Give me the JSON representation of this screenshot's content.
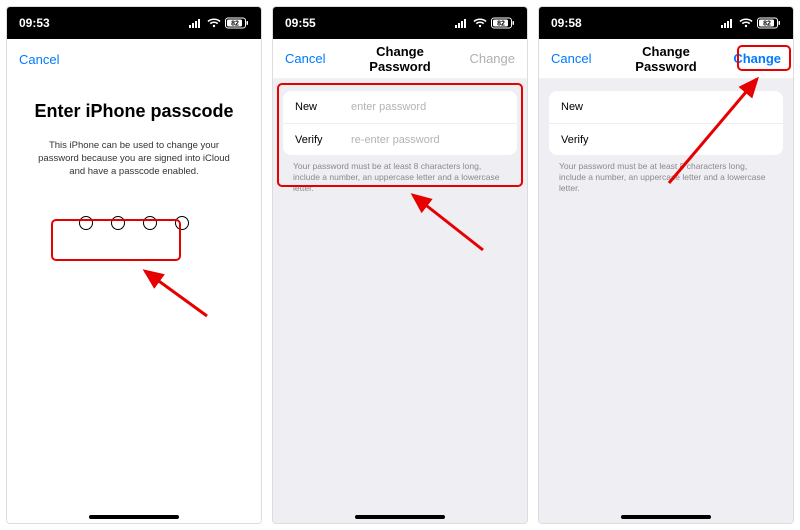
{
  "status": {
    "battery": "82"
  },
  "screens": {
    "s1": {
      "time": "09:53",
      "cancel": "Cancel",
      "title": "Enter iPhone passcode",
      "desc": "This iPhone can be used to change your password because you are signed into iCloud and have a passcode enabled."
    },
    "s2": {
      "time": "09:55",
      "cancel": "Cancel",
      "title": "Change Password",
      "change": "Change",
      "new_label": "New",
      "new_placeholder": "enter password",
      "verify_label": "Verify",
      "verify_placeholder": "re-enter password",
      "hint": "Your password must be at least 8 characters long, include a number, an uppercase letter and a lowercase letter."
    },
    "s3": {
      "time": "09:58",
      "cancel": "Cancel",
      "title": "Change Password",
      "change": "Change",
      "new_label": "New",
      "verify_label": "Verify",
      "hint": "Your password must be at least 8 characters long, include a number, an uppercase letter and a lowercase letter."
    }
  }
}
